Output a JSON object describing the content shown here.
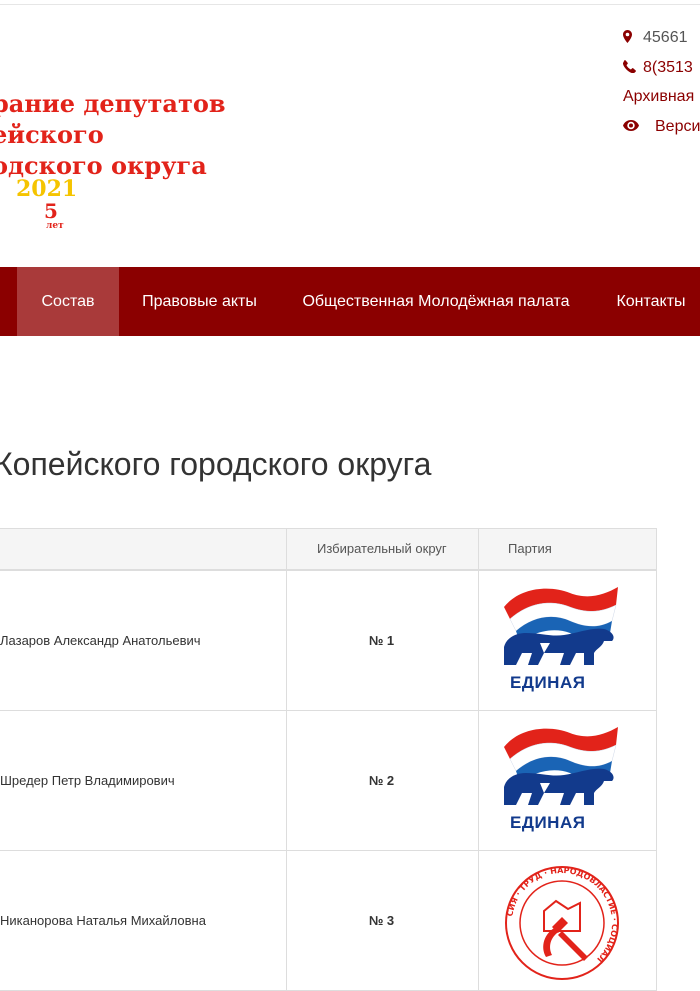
{
  "header": {
    "logo_lines": [
      "рание депутатов",
      "ейского",
      "одского округа"
    ],
    "logo_year": "2021",
    "logo_five": "5",
    "logo_let": "лет",
    "contacts": {
      "address": "45661",
      "phone": "8(3513",
      "archive": "Архивная",
      "version": "Верси"
    }
  },
  "nav": {
    "items": [
      "Состав",
      "Правовые акты",
      "Общественная Молодёжная палата",
      "Контакты"
    ],
    "active": "Состав"
  },
  "page": {
    "title": "Копейского городского округа"
  },
  "table": {
    "headers": [
      "",
      "Избирательный округ",
      "Партия"
    ],
    "rows": [
      {
        "name": "Лазаров Александр Анатольевич",
        "district": "№ 1",
        "party": "ЕДИНАЯ"
      },
      {
        "name": "Шредер Петр Владимирович",
        "district": "№ 2",
        "party": "ЕДИНАЯ"
      },
      {
        "name": "Никанорова Наталья Михайловна",
        "district": "№ 3",
        "party": "КПРФ"
      }
    ]
  },
  "kprf_ring_text": "СИЯ · ТРУД · НАРОДОВЛАСТИЕ · СОЦИАЛ",
  "colors": {
    "brand": "#8b0000",
    "nav_active": "#a93a3a",
    "logo_red": "#e2231a",
    "logo_yellow": "#f5c400"
  },
  "icons": [
    "map-marker-icon",
    "phone-icon",
    "eye-icon"
  ]
}
